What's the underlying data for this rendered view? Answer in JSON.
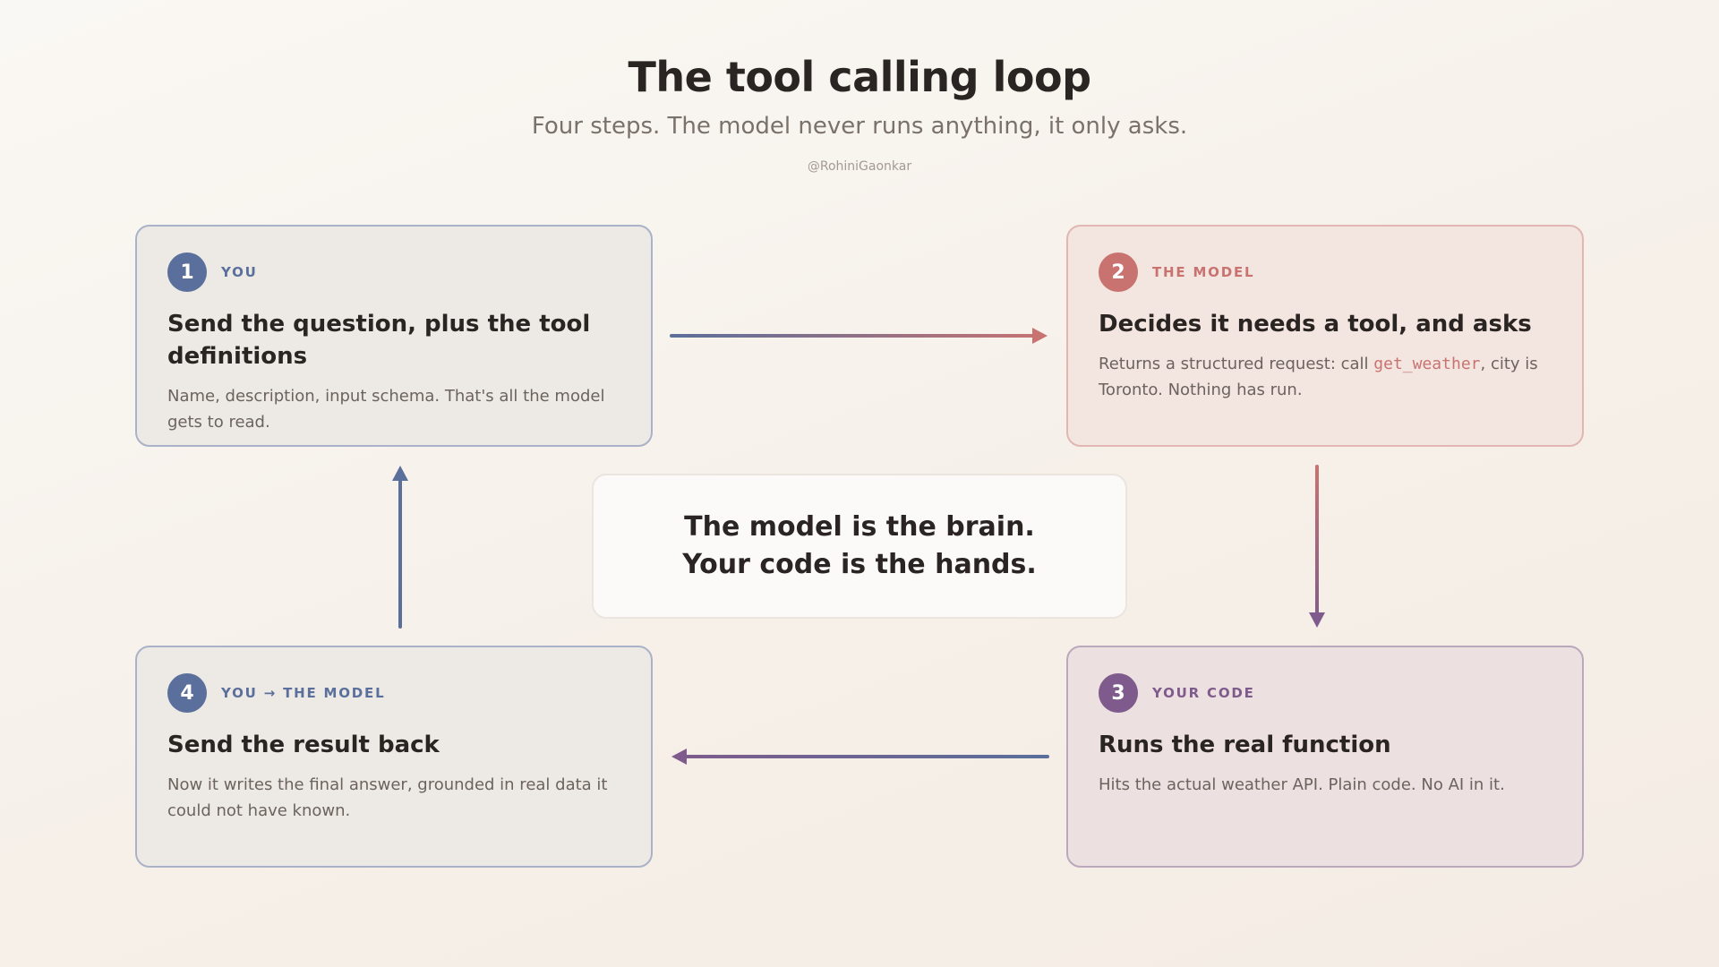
{
  "header": {
    "title": "The tool calling loop",
    "subtitle": "Four steps. The model never runs anything, it only asks.",
    "handle": "@RohiniGaonkar"
  },
  "steps": [
    {
      "number": "1",
      "role": "YOU",
      "title": "Send the question, plus the tool definitions",
      "description": "Name, description, input schema. That's all the model gets to read."
    },
    {
      "number": "2",
      "role": "THE MODEL",
      "title": "Decides it needs a tool, and asks",
      "description_before": "Returns a structured request: call ",
      "code": "get_weather",
      "description_after": ", city is Toronto. Nothing has run."
    },
    {
      "number": "3",
      "role": "YOUR CODE",
      "title": "Runs the real function",
      "description": "Hits the actual weather API. Plain code. No AI in it."
    },
    {
      "number": "4",
      "role": "YOU → THE MODEL",
      "title": "Send the result back",
      "description": "Now it writes the final answer, grounded in real data it could not have known."
    }
  ],
  "center": {
    "line1": "The model is the brain.",
    "line2": "Your code is the hands."
  },
  "colors": {
    "you": "#5a6f9b",
    "model": "#c97371",
    "code": "#7e5b8c"
  },
  "icons": {
    "arrow_right": "arrow-right-icon",
    "arrow_down": "arrow-down-icon",
    "arrow_left": "arrow-left-icon",
    "arrow_up": "arrow-up-icon"
  }
}
